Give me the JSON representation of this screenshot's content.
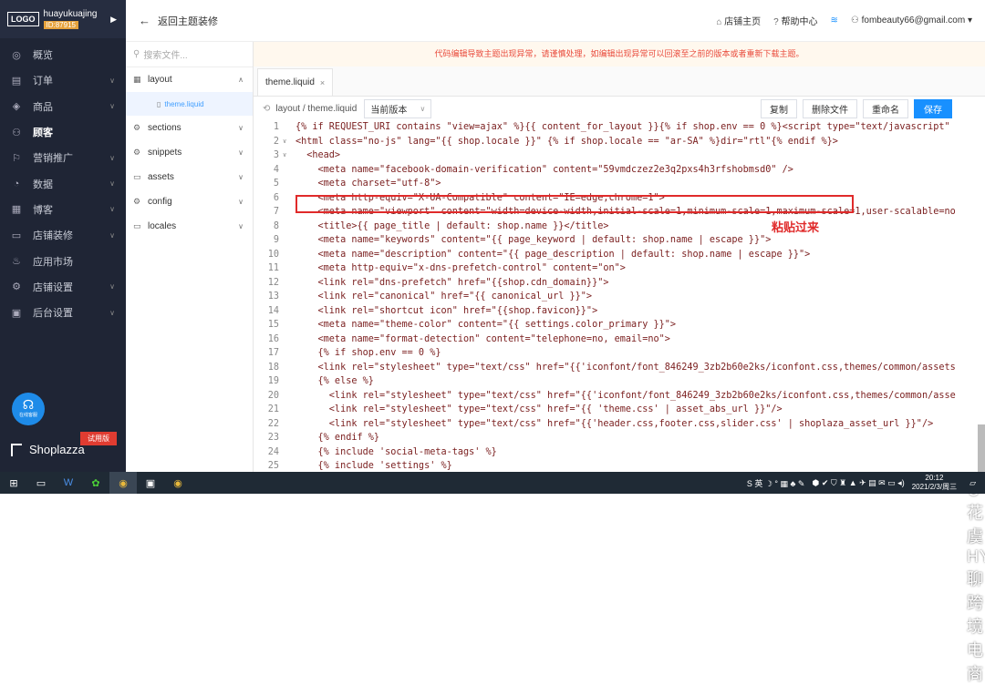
{
  "brand": {
    "logo": "LOGO",
    "name": "huayukuajing",
    "id": "ID:87915",
    "arrow": "▶"
  },
  "nav": [
    {
      "icon": "◎",
      "label": "概览",
      "chev": ""
    },
    {
      "icon": "▤",
      "label": "订单",
      "chev": "∨"
    },
    {
      "icon": "◈",
      "label": "商品",
      "chev": "∨"
    },
    {
      "icon": "⚇",
      "label": "顾客",
      "chev": ""
    },
    {
      "icon": "⚐",
      "label": "营销推广",
      "chev": "∨"
    },
    {
      "icon": "◔",
      "label": "数据",
      "chev": "∨"
    },
    {
      "icon": "▦",
      "label": "博客",
      "chev": "∨"
    },
    {
      "icon": "▭",
      "label": "店铺装修",
      "chev": "∨"
    },
    {
      "icon": "♨",
      "label": "应用市场",
      "chev": ""
    },
    {
      "icon": "⚙",
      "label": "店铺设置",
      "chev": "∨"
    },
    {
      "icon": "▣",
      "label": "后台设置",
      "chev": "∨"
    }
  ],
  "service": {
    "label": "在线客服",
    "icon": "☊"
  },
  "trial": "试用版",
  "shop_name": "Shoplazza",
  "topbar": {
    "back": "返回主题装修",
    "home": "店铺主页",
    "help": "帮助中心",
    "email": "fombeauty66@gmail.com"
  },
  "search_placeholder": "搜索文件...",
  "folders": [
    {
      "label": "layout",
      "icon": "▦",
      "chev": "∧"
    },
    {
      "label": "sections",
      "icon": "⚙",
      "chev": "∨"
    },
    {
      "label": "snippets",
      "icon": "⚙",
      "chev": "∨"
    },
    {
      "label": "assets",
      "icon": "▭",
      "chev": "∨"
    },
    {
      "label": "config",
      "icon": "⚙",
      "chev": "∨"
    },
    {
      "label": "locales",
      "icon": "▭",
      "chev": "∨"
    }
  ],
  "active_file": "theme.liquid",
  "warning": "代码编辑导致主题出现异常，请谨慎处理，如编辑出现异常可以回滚至之前的版本或者重新下载主题。",
  "tab": {
    "label": "theme.liquid",
    "close": "×"
  },
  "toolbar": {
    "path": "layout / theme.liquid",
    "version": "当前版本",
    "copy": "复制",
    "delete": "删除文件",
    "rename": "重命名",
    "save": "保存"
  },
  "code_lines": [
    "{% if REQUEST_URI contains \"view=ajax\" %}{{ content_for_layout }}{% if shop.env == 0 %}<script type=\"text/javascript\"",
    "<html class=\"no-js\" lang=\"{{ shop.locale }}\" {% if shop.locale == \"ar-SA\" %}dir=\"rtl\"{% endif %}>",
    "  <head>",
    "    <meta name=\"facebook-domain-verification\" content=\"59vmdczez2e3q2pxs4h3rfshobmsd0\" />",
    "    <meta charset=\"utf-8\">",
    "    <meta http-equiv=\"X-UA-Compatible\" content=\"IE=edge,chrome=1\">",
    "    <meta name=\"viewport\" content=\"width=device-width,initial-scale=1,minimum-scale=1,maximum-scale=1,user-scalable=no",
    "    <title>{{ page_title | default: shop.name }}</title>",
    "    <meta name=\"keywords\" content=\"{{ page_keyword | default: shop.name | escape }}\">",
    "    <meta name=\"description\" content=\"{{ page_description | default: shop.name | escape }}\">",
    "    <meta http-equiv=\"x-dns-prefetch-control\" content=\"on\">",
    "    <link rel=\"dns-prefetch\" href=\"{{shop.cdn_domain}}\">",
    "    <link rel=\"canonical\" href=\"{{ canonical_url }}\">",
    "    <link rel=\"shortcut icon\" href=\"{{shop.favicon}}\">",
    "    <meta name=\"theme-color\" content=\"{{ settings.color_primary }}\">",
    "    <meta name=\"format-detection\" content=\"telephone=no, email=no\">",
    "    {% if shop.env == 0 %}",
    "    <link rel=\"stylesheet\" type=\"text/css\" href=\"{{'iconfont/font_846249_3zb2b60e2ks/iconfont.css,themes/common/assets",
    "    {% else %}",
    "      <link rel=\"stylesheet\" type=\"text/css\" href=\"{{'iconfont/font_846249_3zb2b60e2ks/iconfont.css,themes/common/asse",
    "      <link rel=\"stylesheet\" type=\"text/css\" href=\"{{ 'theme.css' | asset_abs_url }}\"/>",
    "      <link rel=\"stylesheet\" type=\"text/css\" href=\"{{'header.css,footer.css,slider.css' | shoplaza_asset_url }}\"/>",
    "    {% endif %}",
    "    {% include 'social-meta-tags' %}",
    "    {% include 'settings' %}"
  ],
  "annotation": "粘贴过来",
  "watermark": "花虞HY聊跨境电商",
  "taskbar": {
    "tray_text": "S 英 ☽ ° ▦ ♣ ✎",
    "time": "20:12",
    "date": "2021/2/3/周三"
  }
}
